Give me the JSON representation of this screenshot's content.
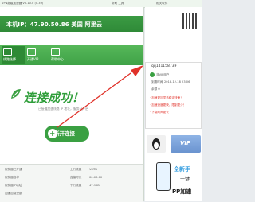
{
  "titlebar": {
    "title": "VPN超级加速器  V5.10.0 (0.39)",
    "menu": "帮助  工具"
  },
  "right_header": {
    "title": "相关软件"
  },
  "ip_banner": {
    "text": "本机IP：47.90.50.86  美国 阿里云"
  },
  "nav": {
    "items": [
      {
        "label": "线路选择"
      },
      {
        "label": "开通VIP"
      },
      {
        "label": "帮助中心"
      }
    ]
  },
  "status": {
    "headline": "连接成功！",
    "subtext": "已接通加速线路 IP 地址，服务已开启"
  },
  "connect_button": {
    "label": "断开连接"
  },
  "info_table": {
    "rows": [
      {
        "left": "服务器已开通",
        "mid": "上行流量",
        "value": "V.KTB"
      },
      {
        "left": "服务器名称",
        "mid": "连接时长",
        "value": "00:00:00"
      },
      {
        "left": "服务器IP地址",
        "mid": "下行流量",
        "value": "47.90B"
      },
      {
        "left": "加速加载全部",
        "mid": "",
        "value": ""
      }
    ]
  },
  "user": {
    "name": "qq141158739",
    "level": "非VIP用户",
    "expiry_label": "到期时间",
    "expiry": "2018-12-18  23:06",
    "balance": "余额 0",
    "link1": "· 加速更加灵活稳定快速！",
    "link2": "· 加速速度更快，限制更少！",
    "link3": "· 下载时间更长"
  },
  "side_buttons": {
    "vip": "VIP"
  },
  "ad": {
    "line1": "全新手",
    "line2": "一键",
    "line3": "PP加速"
  },
  "colors": {
    "brand_green": "#3aa042",
    "accent_red": "#e0322a"
  }
}
